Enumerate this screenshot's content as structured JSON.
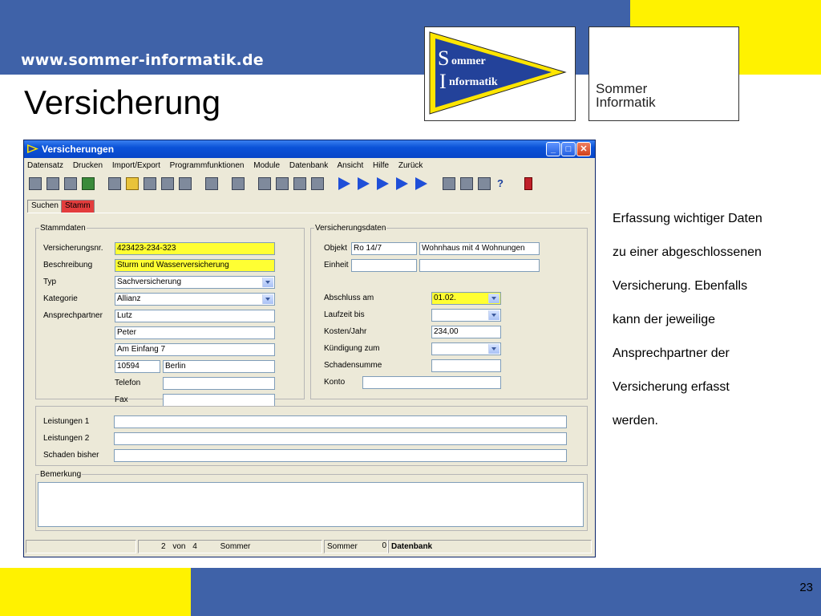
{
  "slide": {
    "url": "www.sommer-informatik.de",
    "title": "Versicherung",
    "logo_line1": "ommer",
    "logo_line2": "nformatik",
    "logo_initial1": "S",
    "logo_initial2": "I",
    "logo2_line1": "Sommer",
    "logo2_line2": "Informatik",
    "side_text_lines": [
      "Erfassung wichtiger Daten",
      "zu einer abgeschlossenen",
      "Versicherung. Ebenfalls",
      "kann der jeweilige",
      "Ansprechpartner der",
      "Versicherung erfasst",
      "werden."
    ],
    "page_number": "23",
    "colors": {
      "band": "#3f62a8",
      "yellow": "#fff200"
    }
  },
  "window": {
    "title": "Versicherungen",
    "controls": {
      "minimize": "_",
      "maximize": "□",
      "close": "✕"
    },
    "menu": [
      "Datensatz",
      "Drucken",
      "Import/Export",
      "Programmfunktionen",
      "Module",
      "Datenbank",
      "Ansicht",
      "Hilfe",
      "Zurück"
    ],
    "tabs": [
      "Suchen",
      "Stamm"
    ],
    "active_tab": "Stamm",
    "help_icon": "?"
  },
  "stammdaten": {
    "legend": "Stammdaten",
    "versicherungsnr_label": "Versicherungsnr.",
    "versicherungsnr": "423423-234-323",
    "beschreibung_label": "Beschreibung",
    "beschreibung": "Sturm und Wasserversicherung",
    "typ_label": "Typ",
    "typ": "Sachversicherung",
    "kategorie_label": "Kategorie",
    "kategorie": "Allianz",
    "ansprechpartner_label": "Ansprechpartner",
    "name": "Lutz",
    "vorname": "Peter",
    "strasse": "Am Einfang 7",
    "plz": "10594",
    "ort": "Berlin",
    "telefon_label": "Telefon",
    "telefon": "",
    "fax_label": "Fax",
    "fax": ""
  },
  "versicherungsdaten": {
    "legend": "Versicherungsdaten",
    "objekt_label": "Objekt",
    "objekt": "Ro 14/7",
    "objekt_beschreibung": "Wohnhaus mit 4 Wohnungen",
    "einheit_label": "Einheit",
    "einheit": "",
    "einheit2": "",
    "abschluss_label": "Abschluss am",
    "abschluss": "01.02.",
    "laufzeit_label": "Laufzeit bis",
    "laufzeit": "",
    "kosten_label": "Kosten/Jahr",
    "kosten": "234,00",
    "kuendigung_label": "Kündigung zum",
    "kuendigung": "",
    "schaden_label": "Schadensumme",
    "schaden": "",
    "konto_label": "Konto",
    "konto": ""
  },
  "leistungen": {
    "l1_label": "Leistungen 1",
    "l1": "",
    "l2_label": "Leistungen 2",
    "l2": "",
    "schaden_label": "Schaden bisher",
    "schaden": ""
  },
  "bemerkung": {
    "legend": "Bemerkung",
    "text": ""
  },
  "statusbar": {
    "record": "2",
    "von": "von",
    "total": "4",
    "user1": "Sommer",
    "user2": "Sommer",
    "count": "0",
    "db": "Datenbank"
  }
}
